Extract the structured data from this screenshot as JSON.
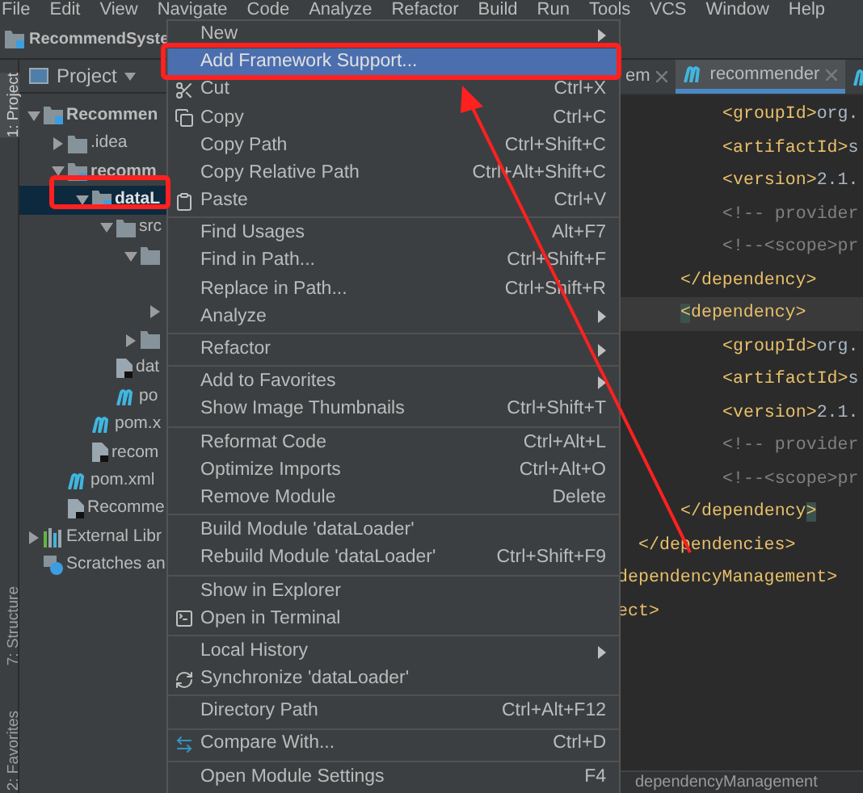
{
  "menu_bar": [
    "File",
    "Edit",
    "View",
    "Navigate",
    "Code",
    "Analyze",
    "Refactor",
    "Build",
    "Run",
    "Tools",
    "VCS",
    "Window",
    "Help"
  ],
  "nav_bar": {
    "label": "RecommendSyste"
  },
  "tool_strip": [
    {
      "label": "1: Project",
      "selected": true
    },
    {
      "label": "7: Structure",
      "selected": false
    },
    {
      "label": "2: Favorites",
      "selected": false
    }
  ],
  "project": {
    "title": "Project",
    "tree": [
      {
        "kind": "module",
        "label": "Recommen",
        "expanded": true,
        "selected": false,
        "children": [
          {
            "kind": "folder",
            "label": ".idea",
            "expanded": false,
            "selected": false
          },
          {
            "kind": "module",
            "label": "recomm",
            "expanded": true,
            "selected": false,
            "children": [
              {
                "kind": "module",
                "label": "dataL",
                "expanded": true,
                "selected": true,
                "children": [
                  {
                    "kind": "folder",
                    "label": "src",
                    "expanded": true,
                    "selected": false,
                    "children": [
                      {
                        "kind": "folder",
                        "expanded": true,
                        "selected": false,
                        "children": [
                          {
                            "selected": false
                          },
                          {
                            "expanded": false,
                            "selected": false
                          }
                        ]
                      },
                      {
                        "kind": "folder",
                        "expanded": false,
                        "selected": false
                      }
                    ]
                  },
                  {
                    "kind": "file",
                    "label": "dat",
                    "selected": false
                  },
                  {
                    "kind": "maven",
                    "label": "po",
                    "selected": false
                  }
                ]
              },
              {
                "kind": "maven",
                "label": "pom.x",
                "selected": false
              },
              {
                "kind": "file",
                "label": "recom",
                "selected": false
              }
            ]
          },
          {
            "kind": "maven",
            "label": "pom.xml",
            "selected": false
          },
          {
            "kind": "file",
            "label": "Recomme",
            "selected": false
          }
        ]
      },
      {
        "kind": "libraries",
        "label": "External Libr",
        "expanded": false,
        "selected": false
      },
      {
        "kind": "scratches",
        "label": "Scratches an",
        "selected": false
      }
    ]
  },
  "tabs": [
    {
      "label": "em",
      "selected": false
    },
    {
      "label": "recommender",
      "selected": true
    },
    {
      "selected": false
    }
  ],
  "code_lines": [
    {
      "kind": "group",
      "children": [
        {
          "kind": "group",
          "children": [
            {
              "kind": "group",
              "children": [
                {
                  "kind": "line",
                  "current": false,
                  "parts": [
                    {
                      "kind": "tag",
                      "text": "<groupId>"
                    },
                    {
                      "kind": "text",
                      "text": "org."
                    }
                  ]
                },
                {
                  "kind": "line",
                  "current": false,
                  "parts": [
                    {
                      "kind": "tag",
                      "text": "<artifactId>"
                    },
                    {
                      "kind": "text",
                      "text": "s"
                    }
                  ]
                },
                {
                  "kind": "line",
                  "current": false,
                  "parts": [
                    {
                      "kind": "tag",
                      "text": "<version>"
                    },
                    {
                      "kind": "text",
                      "text": "2.1."
                    }
                  ]
                },
                {
                  "kind": "line",
                  "current": false,
                  "parts": [
                    {
                      "kind": "comment",
                      "text": "<!-- provider"
                    }
                  ]
                },
                {
                  "kind": "line",
                  "current": false,
                  "parts": [
                    {
                      "kind": "comment",
                      "text": "<!--<scope>pr"
                    }
                  ]
                }
              ]
            },
            {
              "kind": "line",
              "current": false,
              "parts": [
                {
                  "kind": "tag",
                  "text": "</dependency>"
                }
              ]
            },
            {
              "kind": "line",
              "current": true,
              "parts": [
                {
                  "kind": "match",
                  "text": "<"
                },
                {
                  "kind": "tag",
                  "text": "dependency>"
                }
              ],
              "children": [
                {
                  "kind": "line",
                  "current": false,
                  "parts": [
                    {
                      "kind": "tag",
                      "text": "<groupId>"
                    },
                    {
                      "kind": "text",
                      "text": "org."
                    }
                  ]
                },
                {
                  "kind": "line",
                  "current": false,
                  "parts": [
                    {
                      "kind": "tag",
                      "text": "<artifactId>"
                    },
                    {
                      "kind": "text",
                      "text": "s"
                    }
                  ]
                },
                {
                  "kind": "line",
                  "current": false,
                  "parts": [
                    {
                      "kind": "tag",
                      "text": "<version>"
                    },
                    {
                      "kind": "text",
                      "text": "2.1."
                    }
                  ]
                },
                {
                  "kind": "line",
                  "current": false,
                  "parts": [
                    {
                      "kind": "comment",
                      "text": "<!-- provider"
                    }
                  ]
                },
                {
                  "kind": "line",
                  "current": false,
                  "parts": [
                    {
                      "kind": "comment",
                      "text": "<!--<scope>pr"
                    }
                  ]
                }
              ]
            },
            {
              "kind": "line",
              "current": false,
              "parts": [
                {
                  "kind": "tag",
                  "text": "</dependency"
                },
                {
                  "kind": "match",
                  "text": ">"
                }
              ]
            }
          ]
        },
        {
          "kind": "line",
          "current": false,
          "parts": [
            {
              "kind": "tag",
              "text": "</dependencies>"
            }
          ]
        }
      ]
    },
    {
      "kind": "line",
      "current": false,
      "parts": [
        {
          "kind": "tag",
          "text": "dependencyManagement>"
        }
      ]
    },
    {
      "kind": "line",
      "current": false,
      "parts": [
        {
          "kind": "tag",
          "text": "ect>"
        }
      ]
    }
  ],
  "breadcrumb": "dependencyManagement",
  "context_menu": [
    {
      "kind": "item",
      "label": "New",
      "submenu": true,
      "selected": false
    },
    {
      "kind": "item",
      "label": "Add Framework Support...",
      "submenu": false,
      "selected": true
    },
    {
      "kind": "item",
      "label": "Cut",
      "shortcut": "Ctrl+X",
      "submenu": false,
      "selected": false
    },
    {
      "kind": "item",
      "label": "Copy",
      "shortcut": "Ctrl+C",
      "submenu": false,
      "selected": false
    },
    {
      "kind": "item",
      "label": "Copy Path",
      "shortcut": "Ctrl+Shift+C",
      "submenu": false,
      "selected": false
    },
    {
      "kind": "item",
      "label": "Copy Relative Path",
      "shortcut": "Ctrl+Alt+Shift+C",
      "submenu": false,
      "selected": false
    },
    {
      "kind": "item",
      "label": "Paste",
      "shortcut": "Ctrl+V",
      "submenu": false,
      "selected": false
    },
    {
      "kind": "separator"
    },
    {
      "kind": "item",
      "label": "Find Usages",
      "shortcut": "Alt+F7",
      "submenu": false,
      "selected": false
    },
    {
      "kind": "item",
      "label": "Find in Path...",
      "shortcut": "Ctrl+Shift+F",
      "submenu": false,
      "selected": false
    },
    {
      "kind": "item",
      "label": "Replace in Path...",
      "shortcut": "Ctrl+Shift+R",
      "submenu": false,
      "selected": false
    },
    {
      "kind": "item",
      "label": "Analyze",
      "submenu": true,
      "selected": false
    },
    {
      "kind": "separator"
    },
    {
      "kind": "item",
      "label": "Refactor",
      "submenu": true,
      "selected": false
    },
    {
      "kind": "separator"
    },
    {
      "kind": "item",
      "label": "Add to Favorites",
      "submenu": true,
      "selected": false
    },
    {
      "kind": "item",
      "label": "Show Image Thumbnails",
      "shortcut": "Ctrl+Shift+T",
      "submenu": false,
      "selected": false
    },
    {
      "kind": "separator"
    },
    {
      "kind": "item",
      "label": "Reformat Code",
      "shortcut": "Ctrl+Alt+L",
      "submenu": false,
      "selected": false
    },
    {
      "kind": "item",
      "label": "Optimize Imports",
      "shortcut": "Ctrl+Alt+O",
      "submenu": false,
      "selected": false
    },
    {
      "kind": "item",
      "label": "Remove Module",
      "shortcut": "Delete",
      "submenu": false,
      "selected": false
    },
    {
      "kind": "separator"
    },
    {
      "kind": "item",
      "label": "Build Module 'dataLoader'",
      "submenu": false,
      "selected": false
    },
    {
      "kind": "item",
      "label": "Rebuild Module 'dataLoader'",
      "shortcut": "Ctrl+Shift+F9",
      "submenu": false,
      "selected": false
    },
    {
      "kind": "separator"
    },
    {
      "kind": "item",
      "label": "Show in Explorer",
      "submenu": false,
      "selected": false
    },
    {
      "kind": "item",
      "label": "Open in Terminal",
      "submenu": false,
      "selected": false
    },
    {
      "kind": "separator"
    },
    {
      "kind": "item",
      "label": "Local History",
      "submenu": true,
      "selected": false
    },
    {
      "kind": "item",
      "label": "Synchronize 'dataLoader'",
      "submenu": false,
      "selected": false
    },
    {
      "kind": "separator"
    },
    {
      "kind": "item",
      "label": "Directory Path",
      "shortcut": "Ctrl+Alt+F12",
      "submenu": false,
      "selected": false
    },
    {
      "kind": "separator"
    },
    {
      "kind": "item",
      "label": "Compare With...",
      "shortcut": "Ctrl+D",
      "submenu": false,
      "selected": false
    },
    {
      "kind": "separator"
    },
    {
      "kind": "item",
      "label": "Open Module Settings",
      "shortcut": "F4",
      "submenu": false,
      "selected": false
    }
  ]
}
